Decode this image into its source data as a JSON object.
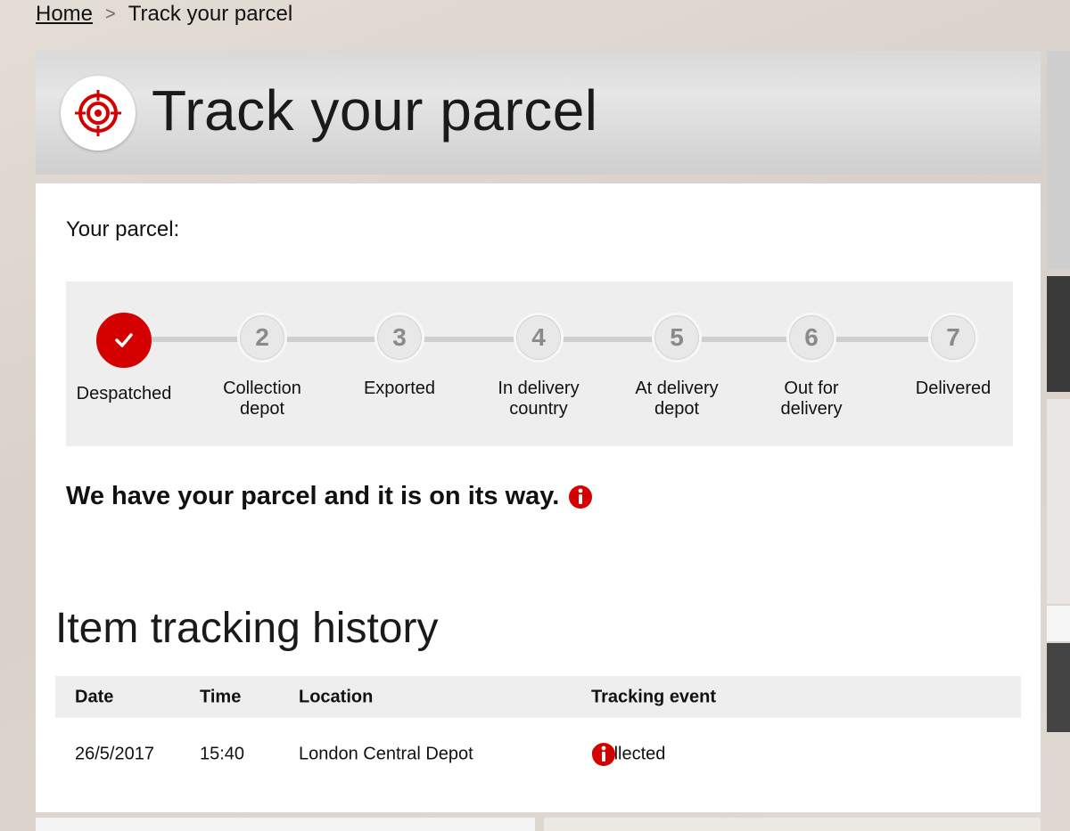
{
  "breadcrumb": {
    "home": "Home",
    "separator": ">",
    "current": "Track your parcel"
  },
  "hero": {
    "title": "Track your parcel",
    "icon": "target-icon"
  },
  "parcel": {
    "label": "Your parcel:",
    "steps": [
      {
        "number": "",
        "label": "Despatched",
        "status": "done"
      },
      {
        "number": "2",
        "label": "Collection depot",
        "status": "pending"
      },
      {
        "number": "3",
        "label": "Exported",
        "status": "pending"
      },
      {
        "number": "4",
        "label": "In delivery country",
        "status": "pending"
      },
      {
        "number": "5",
        "label": "At delivery depot",
        "status": "pending"
      },
      {
        "number": "6",
        "label": "Out for delivery",
        "status": "pending"
      },
      {
        "number": "7",
        "label": "Delivered",
        "status": "pending"
      }
    ],
    "status_message": "We have your parcel and it is on its way."
  },
  "history": {
    "title": "Item tracking history",
    "columns": [
      "Date",
      "Time",
      "Location",
      "Tracking event"
    ],
    "rows": [
      {
        "date": "26/5/2017",
        "time": "15:40",
        "location": "London Central Depot",
        "event": "Collected"
      }
    ]
  },
  "colors": {
    "accent": "#d40000",
    "panel_gray": "#eeeeee"
  }
}
